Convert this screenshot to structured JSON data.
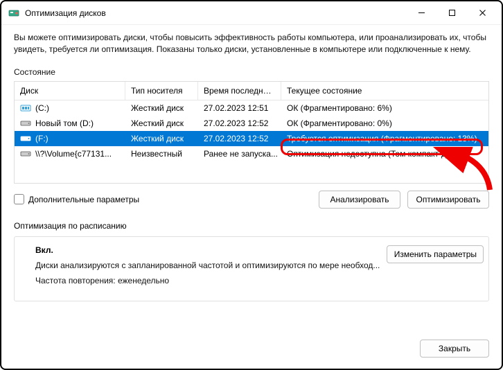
{
  "window": {
    "title": "Оптимизация дисков"
  },
  "intro": "Вы можете оптимизировать диски, чтобы повысить эффективность работы  компьютера, или проанализировать их, чтобы увидеть, требуется ли оптимизация. Показаны только диски, установленные в компьютере или подключенные к нему.",
  "status_label": "Состояние",
  "columns": {
    "disk": "Диск",
    "type": "Тип носителя",
    "time": "Время последнег...",
    "status": "Текущее состояние"
  },
  "rows": [
    {
      "name": "(C:)",
      "type": "Жесткий диск",
      "time": "27.02.2023 12:51",
      "status": "ОК (Фрагментировано: 6%)",
      "icon": "ssd"
    },
    {
      "name": "Новый том (D:)",
      "type": "Жесткий диск",
      "time": "27.02.2023 12:52",
      "status": "ОК (Фрагментировано: 0%)",
      "icon": "hdd"
    },
    {
      "name": "(F:)",
      "type": "Жесткий диск",
      "time": "27.02.2023 12:52",
      "status": "Требуется оптимизация (Фрагментировано: 13%)",
      "icon": "hdd",
      "selected": true
    },
    {
      "name": "\\\\?\\Volume{c77131...",
      "type": "Неизвестный",
      "time": "Ранее не запуска...",
      "status": "Оптимизация недоступна (Том компакт-диска)",
      "icon": "hdd"
    }
  ],
  "adv_params": "Дополнительные параметры",
  "buttons": {
    "analyze": "Анализировать",
    "optimize": "Оптимизировать",
    "change": "Изменить параметры",
    "close": "Закрыть"
  },
  "sched": {
    "label": "Оптимизация по расписанию",
    "on": "Вкл.",
    "line1": "Диски анализируются с запланированной частотой и оптимизируются по мере необход...",
    "line2": "Частота повторения: еженедельно"
  }
}
